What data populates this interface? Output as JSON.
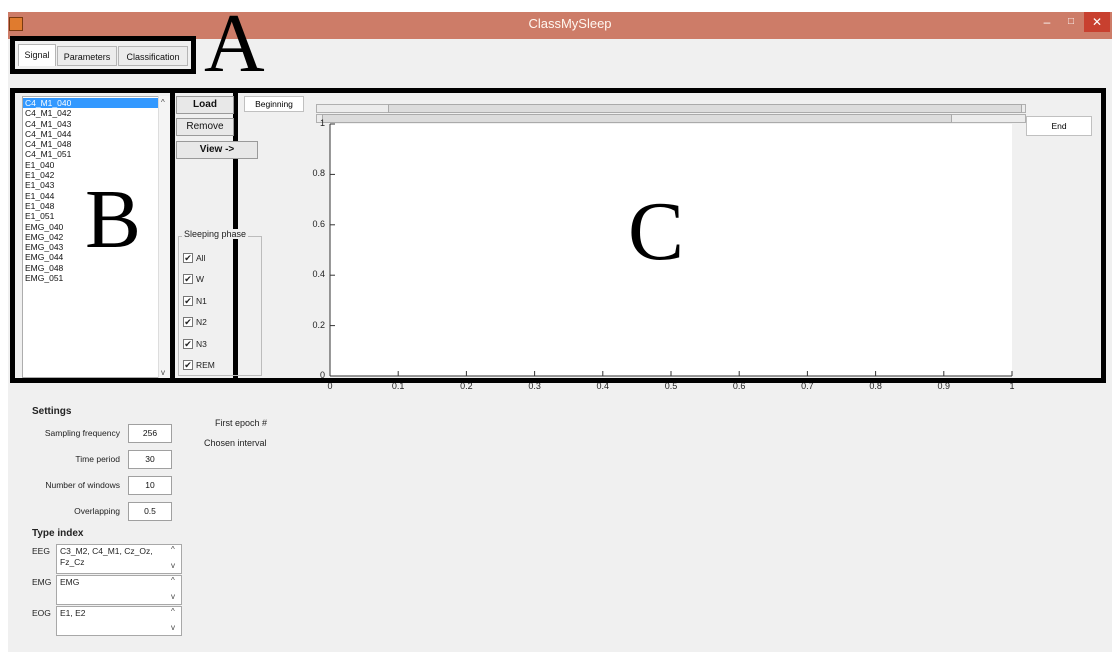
{
  "window": {
    "title": "ClassMySleep",
    "minimize": "–",
    "maximize": "□",
    "close": "✕"
  },
  "tabs": [
    {
      "label": "Signal"
    },
    {
      "label": "Parameters"
    },
    {
      "label": "Classification"
    }
  ],
  "annotations": {
    "a": "A",
    "b": "B",
    "c": "C"
  },
  "channel_list": {
    "items": [
      "C4_M1_040",
      "C4_M1_042",
      "C4_M1_043",
      "C4_M1_044",
      "C4_M1_048",
      "C4_M1_051",
      "E1_040",
      "E1_042",
      "E1_043",
      "E1_044",
      "E1_048",
      "E1_051",
      "EMG_040",
      "EMG_042",
      "EMG_043",
      "EMG_044",
      "EMG_048",
      "EMG_051"
    ],
    "selected_index": 0
  },
  "buttons": {
    "load": "Load",
    "remove": "Remove",
    "view": "View ->"
  },
  "sleeping_phase": {
    "title": "Sleeping phase",
    "options": [
      {
        "label": "All",
        "checked": true
      },
      {
        "label": "W",
        "checked": true
      },
      {
        "label": "N1",
        "checked": true
      },
      {
        "label": "N2",
        "checked": true
      },
      {
        "label": "N3",
        "checked": true
      },
      {
        "label": "REM",
        "checked": true
      }
    ]
  },
  "navigation": {
    "beginning": "Beginning",
    "end": "End"
  },
  "settings": {
    "title": "Settings",
    "fields": [
      {
        "label": "Sampling frequency",
        "value": "256"
      },
      {
        "label": "Time period",
        "value": "30"
      },
      {
        "label": "Number of windows",
        "value": "10"
      },
      {
        "label": "Overlapping",
        "value": "0.5"
      }
    ]
  },
  "info": {
    "first_epoch": "First epoch #",
    "chosen_interval": "Chosen interval"
  },
  "type_index": {
    "title": "Type index",
    "rows": [
      {
        "label": "EEG",
        "value": "C3_M2, C4_M1, Cz_Oz, Fz_Cz"
      },
      {
        "label": "EMG",
        "value": "EMG"
      },
      {
        "label": "EOG",
        "value": "E1, E2"
      }
    ]
  },
  "chart_data": {
    "type": "line",
    "x_ticks": [
      "0",
      "0.1",
      "0.2",
      "0.3",
      "0.4",
      "0.5",
      "0.6",
      "0.7",
      "0.8",
      "0.9",
      "1"
    ],
    "y_ticks": [
      "0",
      "0.2",
      "0.4",
      "0.6",
      "0.8",
      "1"
    ],
    "xlim": [
      0,
      1
    ],
    "ylim": [
      0,
      1
    ],
    "series": []
  }
}
